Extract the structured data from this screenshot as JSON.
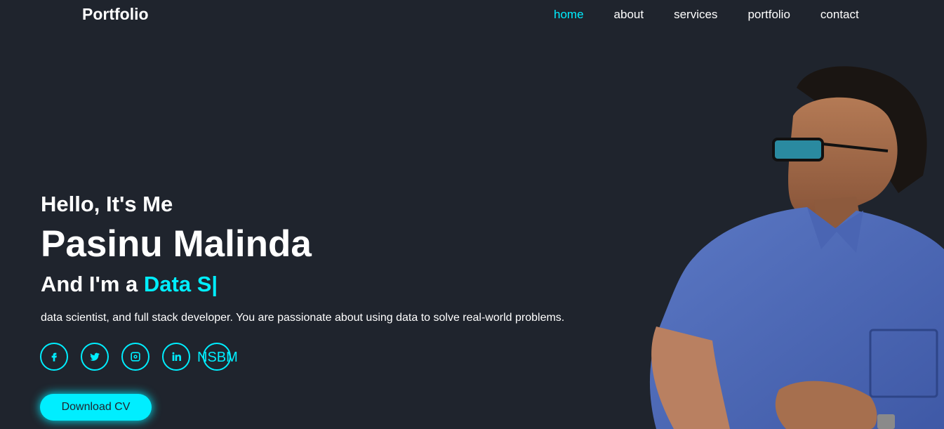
{
  "header": {
    "logo": "Portfolio",
    "nav": [
      "home",
      "about",
      "services",
      "portfolio",
      "contact"
    ],
    "active_nav": "home"
  },
  "hero": {
    "greeting": "Hello, It's Me",
    "name": "Pasinu Malinda",
    "role_prefix": "And I'm a ",
    "role_typed": "Data S|",
    "description": "data scientist, and full stack developer. You are passionate about using data to solve real-world problems."
  },
  "socials": [
    {
      "icon": "facebook-icon"
    },
    {
      "icon": "twitter-icon"
    },
    {
      "icon": "instagram-icon"
    },
    {
      "icon": "linkedin-icon"
    },
    {
      "icon": "nsbm-link",
      "label": "NSBM"
    }
  ],
  "cv_button": "Download CV",
  "colors": {
    "background": "#1f242d",
    "accent": "#00eeff",
    "text": "#ffffff"
  }
}
